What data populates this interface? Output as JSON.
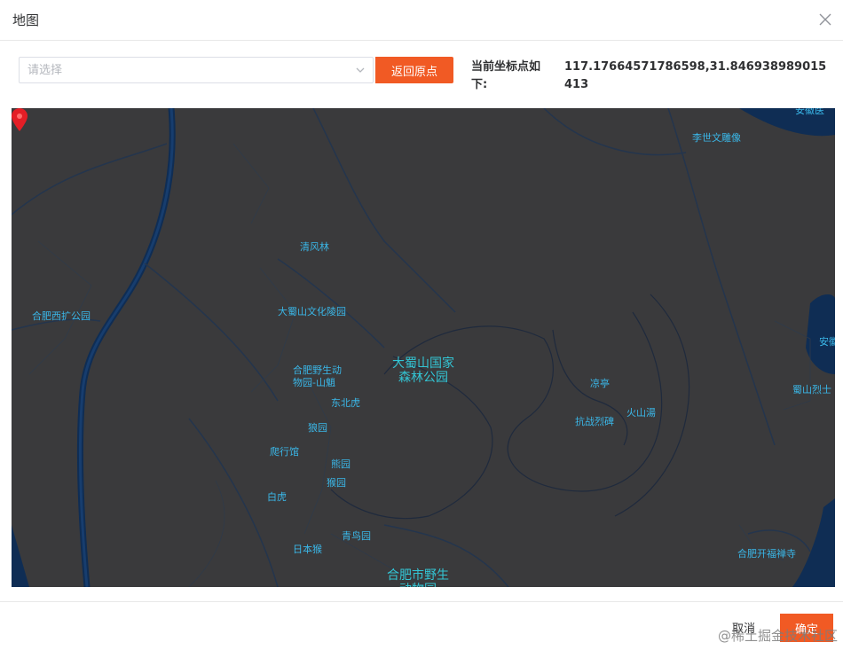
{
  "dialog": {
    "title": "地图"
  },
  "toolbar": {
    "select_placeholder": "请选择",
    "back_button": "返回原点",
    "coord_label": "当前坐标点如下:",
    "coord_value": "117.17664571786598,31.846938989015413"
  },
  "map": {
    "poi_labels": [
      "李世文雕像",
      "清风林",
      "合肥西扩公园",
      "大蜀山文化陵园",
      "合肥野生动物园-山魈",
      "东北虎",
      "狼园",
      "爬行馆",
      "熊园",
      "猴园",
      "白虎",
      "青鸟园",
      "日本猴",
      "凉亭",
      "抗战烈碑",
      "火山湯",
      "蜀山烈士",
      "合肥开福禅寺",
      "安徽",
      "安徽医"
    ],
    "main_label": "大蜀山国家森林公园",
    "bottom_label": "合肥市野生动物园",
    "marker_icon": "map-pin-icon",
    "background_color": "#3a3a3c",
    "road_color": "#0f2d54",
    "marker_color": "#e41e26"
  },
  "footer": {
    "cancel_button": "取消",
    "confirm_button": "确定",
    "watermark": "@稀土掘金技术社区"
  },
  "colors": {
    "accent": "#f15a24",
    "poi_text": "#3ab7e8"
  }
}
